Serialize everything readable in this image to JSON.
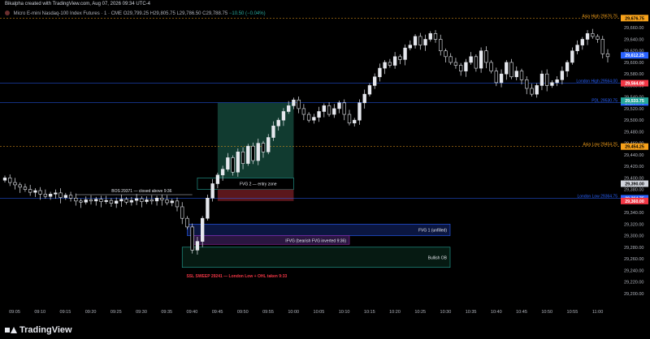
{
  "header": {
    "caption": "Bikalpha created with TradingView.com, Aug 07, 2026 09:34 UTC-4"
  },
  "symbol": {
    "name": "Micro E-mini Nasdaq-100 Index Futures · 1 · CME",
    "open": "O29,799.25",
    "high": "H29,805.75",
    "low": "L29,786.50",
    "close": "C29,788.75",
    "change": "−10.50 (−0.04%)"
  },
  "colors": {
    "up": "#e6e8ee",
    "down": "#e6e8ee",
    "blue": "#2962ff",
    "orange": "#f7a21b",
    "red": "#f23645",
    "green": "#26a69a"
  },
  "footer": {
    "brand": "TradingView"
  },
  "chart_data": {
    "type": "candlestick",
    "ylim": [
      29180,
      29680
    ],
    "price_ticks": [
      29200,
      29220,
      29240,
      29260,
      29280,
      29300,
      29320,
      29340,
      29360,
      29380,
      29400,
      29420,
      29440,
      29460,
      29480,
      29500,
      29520,
      29540,
      29560,
      29580,
      29600,
      29620,
      29640,
      29660
    ],
    "time_labels": [
      "09:05",
      "09:10",
      "09:15",
      "09:20",
      "09:25",
      "09:30",
      "09:35",
      "09:40",
      "09:45",
      "09:50",
      "09:55",
      "10:00",
      "10:05",
      "10:10",
      "10:15",
      "10:20",
      "10:25",
      "10:30",
      "10:35",
      "10:40",
      "10:45",
      "10:50",
      "10:55",
      "11:00"
    ],
    "closes": [
      29400,
      29392,
      29388,
      29384,
      29380,
      29375,
      29378,
      29372,
      29368,
      29372,
      29374,
      29366,
      29370,
      29365,
      29360,
      29358,
      29362,
      29360,
      29363,
      29359,
      29361,
      29356,
      29360,
      29363,
      29358,
      29361,
      29364,
      29359,
      29362,
      29360,
      29365,
      29362,
      29357,
      29360,
      29350,
      29330,
      29315,
      29275,
      29290,
      29330,
      29365,
      29390,
      29405,
      29415,
      29435,
      29410,
      29445,
      29425,
      29455,
      29430,
      29460,
      29445,
      29470,
      29490,
      29500,
      29515,
      29525,
      29535,
      29520,
      29510,
      29500,
      29505,
      29515,
      29525,
      29510,
      29520,
      29530,
      29510,
      29495,
      29500,
      29530,
      29545,
      29560,
      29575,
      29590,
      29600,
      29595,
      29610,
      29605,
      29625,
      29630,
      29645,
      29630,
      29640,
      29650,
      29640,
      29620,
      29610,
      29600,
      29595,
      29585,
      29600,
      29610,
      29590,
      29620,
      29600,
      29585,
      29565,
      29580,
      29600,
      29575,
      29585,
      29570,
      29555,
      29545,
      29560,
      29580,
      29560,
      29565,
      29570,
      29585,
      29600,
      29620,
      29630,
      29640,
      29650,
      29645,
      29640,
      29615,
      29610
    ],
    "price_levels": [
      {
        "label": "Asia High 29676.75",
        "price": 29676.75,
        "color": "#f7a21b",
        "tag": "29,676.75"
      },
      {
        "label": "London High 29564.00",
        "price": 29564.0,
        "color": "#2962ff",
        "tag": "29,564.00"
      },
      {
        "label": "PDL 29530.75",
        "price": 29530.75,
        "color": "#2962ff",
        "tag": "29,530.75"
      },
      {
        "label": "Asia Low 29454.25",
        "price": 29454.25,
        "color": "#f7a21b",
        "tag": "29,454.25"
      },
      {
        "label": "London Low 29364.75",
        "price": 29364.75,
        "color": "#2962ff",
        "tag": "29,364.75"
      }
    ],
    "price_tags": [
      {
        "text": "29,612.25",
        "price": 29612.25,
        "color": "#2962ff"
      },
      {
        "text": "29,533.75",
        "price": 29533.75,
        "color": "#26a69a"
      },
      {
        "text": "29,390.00",
        "price": 29390.0,
        "color": "#d1d4dc"
      },
      {
        "text": "29,360.00",
        "price": 29360.0,
        "color": "#f23645"
      }
    ],
    "annotations": [
      {
        "id": "bos",
        "text": "BOS 29371 — closed above 9:36"
      },
      {
        "id": "fvg2",
        "text": "FVG 2 — entry zone"
      },
      {
        "id": "fvg1",
        "text": "FVG 1 (unfilled)"
      },
      {
        "id": "ifvg",
        "text": "IFVG (bearish FVG inverted 9:36)"
      },
      {
        "id": "ob",
        "text": "Bullish OB"
      },
      {
        "id": "ssl",
        "text": "SSL SWEEP 29241 — London Low + OHL taken 9:33"
      }
    ]
  }
}
